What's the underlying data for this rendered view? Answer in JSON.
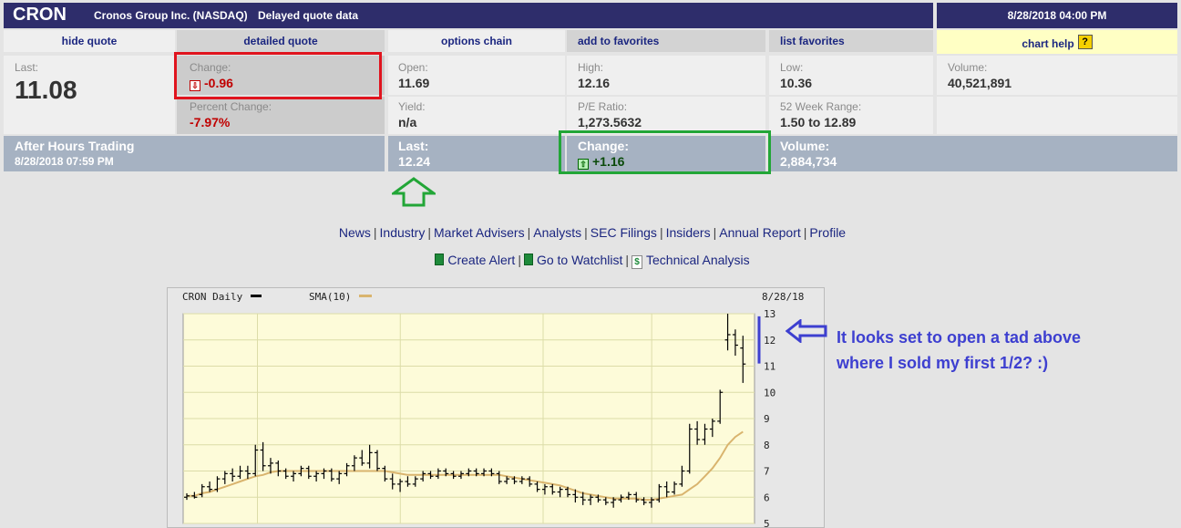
{
  "header": {
    "ticker": "CRON",
    "company": "Cronos Group Inc. (NASDAQ)",
    "delayed": "Delayed quote data",
    "datetime": "8/28/2018 04:00 PM"
  },
  "tabs": {
    "hide_quote": "hide quote",
    "detailed_quote": "detailed quote",
    "options_chain": "options chain",
    "add_favorites": "add to favorites",
    "list_favorites": "list favorites",
    "chart_help": "chart help",
    "chart_help_icon": "?"
  },
  "quote": {
    "last_label": "Last:",
    "last_value": "11.08",
    "change_label": "Change:",
    "change_value": "-0.96",
    "pct_label": "Percent Change:",
    "pct_value": "-7.97%",
    "open_label": "Open:",
    "open_value": "11.69",
    "yield_label": "Yield:",
    "yield_value": "n/a",
    "high_label": "High:",
    "high_value": "12.16",
    "pe_label": "P/E Ratio:",
    "pe_value": "1,273.5632",
    "low_label": "Low:",
    "low_value": "10.36",
    "range_label": "52 Week Range:",
    "range_value": "1.50 to 12.89",
    "volume_label": "Volume:",
    "volume_value": "40,521,891"
  },
  "after_hours": {
    "title": "After Hours Trading",
    "datetime": "8/28/2018 07:59 PM",
    "last_label": "Last:",
    "last_value": "12.24",
    "change_label": "Change:",
    "change_value": "+1.16",
    "volume_label": "Volume:",
    "volume_value": "2,884,734"
  },
  "nav_links": [
    "News",
    "Industry",
    "Market Advisers",
    "Analysts",
    "SEC Filings",
    "Insiders",
    "Annual Report",
    "Profile"
  ],
  "tools": {
    "create_alert": "Create Alert",
    "watchlist": "Go to Watchlist",
    "technical": "Technical Analysis",
    "dollar": "$"
  },
  "annotation": {
    "line1": "It looks set to open a tad above",
    "line2": "where I sold my first 1/2?  :)"
  },
  "colors": {
    "header": "#2e2d6b",
    "link": "#1b2680",
    "negative": "#c00000",
    "positive": "#006600",
    "red_box": "#e0141e",
    "green_box": "#22a637",
    "annotation": "#3d3fd0",
    "chart_bg": "#fdfbd9",
    "sma": "#d9b46e"
  },
  "chart_data": {
    "type": "line",
    "title": "CRON Daily",
    "legend": [
      "CRON Daily",
      "SMA(10)"
    ],
    "date_label": "8/28/18",
    "ylim": [
      5,
      13
    ],
    "yticks": [
      5,
      6,
      7,
      8,
      9,
      10,
      11,
      12,
      13
    ],
    "grid": true,
    "series": [
      {
        "name": "CRON Daily",
        "ohlc": [
          [
            6.0,
            6.15,
            5.9,
            6.05
          ],
          [
            6.05,
            6.2,
            5.95,
            6.0
          ],
          [
            6.1,
            6.5,
            6.0,
            6.4
          ],
          [
            6.4,
            6.6,
            6.2,
            6.3
          ],
          [
            6.3,
            6.8,
            6.2,
            6.7
          ],
          [
            6.7,
            7.0,
            6.5,
            6.9
          ],
          [
            6.9,
            7.1,
            6.6,
            6.8
          ],
          [
            6.8,
            7.2,
            6.7,
            7.0
          ],
          [
            7.0,
            7.2,
            6.7,
            6.9
          ],
          [
            6.9,
            8.0,
            6.8,
            7.8
          ],
          [
            7.8,
            8.1,
            7.0,
            7.2
          ],
          [
            7.2,
            7.5,
            6.9,
            7.3
          ],
          [
            7.3,
            7.4,
            6.8,
            7.0
          ],
          [
            7.0,
            7.1,
            6.7,
            6.8
          ],
          [
            6.8,
            7.0,
            6.6,
            6.9
          ],
          [
            6.9,
            7.2,
            6.8,
            7.1
          ],
          [
            7.1,
            7.2,
            6.7,
            6.8
          ],
          [
            6.8,
            7.0,
            6.6,
            6.9
          ],
          [
            6.9,
            7.1,
            6.7,
            7.0
          ],
          [
            7.0,
            7.1,
            6.6,
            6.7
          ],
          [
            6.7,
            7.0,
            6.5,
            6.9
          ],
          [
            6.9,
            7.3,
            6.8,
            7.2
          ],
          [
            7.2,
            7.6,
            7.0,
            7.5
          ],
          [
            7.5,
            7.8,
            7.2,
            7.3
          ],
          [
            7.3,
            8.0,
            7.1,
            7.7
          ],
          [
            7.7,
            7.8,
            7.0,
            7.1
          ],
          [
            7.1,
            7.2,
            6.6,
            6.7
          ],
          [
            6.7,
            6.9,
            6.3,
            6.5
          ],
          [
            6.5,
            6.7,
            6.2,
            6.6
          ],
          [
            6.6,
            6.8,
            6.4,
            6.5
          ],
          [
            6.5,
            6.8,
            6.4,
            6.7
          ],
          [
            6.7,
            7.0,
            6.6,
            6.9
          ],
          [
            6.9,
            7.0,
            6.7,
            6.8
          ],
          [
            6.8,
            7.1,
            6.7,
            7.0
          ],
          [
            7.0,
            7.1,
            6.8,
            6.9
          ],
          [
            6.9,
            7.0,
            6.7,
            6.8
          ],
          [
            6.8,
            7.0,
            6.7,
            6.9
          ],
          [
            6.9,
            7.1,
            6.8,
            7.0
          ],
          [
            7.0,
            7.1,
            6.8,
            6.9
          ],
          [
            6.9,
            7.1,
            6.8,
            7.0
          ],
          [
            7.0,
            7.1,
            6.8,
            6.9
          ],
          [
            6.9,
            7.0,
            6.5,
            6.6
          ],
          [
            6.6,
            6.8,
            6.5,
            6.7
          ],
          [
            6.7,
            6.8,
            6.5,
            6.6
          ],
          [
            6.6,
            6.8,
            6.5,
            6.7
          ],
          [
            6.7,
            6.8,
            6.4,
            6.5
          ],
          [
            6.5,
            6.6,
            6.2,
            6.3
          ],
          [
            6.3,
            6.5,
            6.1,
            6.4
          ],
          [
            6.4,
            6.5,
            6.1,
            6.2
          ],
          [
            6.2,
            6.4,
            6.0,
            6.3
          ],
          [
            6.3,
            6.4,
            6.0,
            6.1
          ],
          [
            6.1,
            6.3,
            5.8,
            6.0
          ],
          [
            6.0,
            6.2,
            5.7,
            5.9
          ],
          [
            5.9,
            6.1,
            5.7,
            6.0
          ],
          [
            6.0,
            6.1,
            5.8,
            5.9
          ],
          [
            5.9,
            6.0,
            5.7,
            5.8
          ],
          [
            5.8,
            6.0,
            5.6,
            5.9
          ],
          [
            5.9,
            6.1,
            5.8,
            6.0
          ],
          [
            6.0,
            6.2,
            5.9,
            6.1
          ],
          [
            6.1,
            6.2,
            5.8,
            5.9
          ],
          [
            5.9,
            6.0,
            5.7,
            5.8
          ],
          [
            5.8,
            6.0,
            5.6,
            5.9
          ],
          [
            5.9,
            6.5,
            5.8,
            6.4
          ],
          [
            6.4,
            6.6,
            6.0,
            6.2
          ],
          [
            6.2,
            6.6,
            6.1,
            6.5
          ],
          [
            6.5,
            7.2,
            6.4,
            7.0
          ],
          [
            7.0,
            8.8,
            6.9,
            8.6
          ],
          [
            8.6,
            8.9,
            8.0,
            8.2
          ],
          [
            8.2,
            8.8,
            8.0,
            8.6
          ],
          [
            8.6,
            9.0,
            8.3,
            8.9
          ],
          [
            8.9,
            10.1,
            8.8,
            10.0
          ],
          [
            12.0,
            13.0,
            11.6,
            12.2
          ],
          [
            12.2,
            12.4,
            11.4,
            11.8
          ],
          [
            11.69,
            12.16,
            10.36,
            11.08
          ]
        ]
      },
      {
        "name": "SMA(10)",
        "values": [
          6.05,
          6.05,
          6.15,
          6.2,
          6.3,
          6.4,
          6.5,
          6.6,
          6.7,
          6.8,
          6.85,
          6.95,
          7.0,
          7.0,
          7.0,
          7.0,
          7.0,
          7.0,
          7.0,
          7.0,
          7.0,
          7.0,
          7.0,
          7.0,
          7.0,
          7.0,
          7.0,
          6.95,
          6.9,
          6.85,
          6.85,
          6.85,
          6.85,
          6.85,
          6.85,
          6.85,
          6.85,
          6.85,
          6.85,
          6.85,
          6.85,
          6.85,
          6.8,
          6.75,
          6.7,
          6.65,
          6.6,
          6.55,
          6.5,
          6.45,
          6.35,
          6.25,
          6.15,
          6.1,
          6.05,
          6.0,
          5.95,
          5.95,
          5.95,
          5.95,
          5.9,
          5.9,
          5.95,
          6.0,
          6.05,
          6.1,
          6.3,
          6.5,
          6.8,
          7.1,
          7.5,
          8.0,
          8.3,
          8.5
        ]
      }
    ]
  }
}
